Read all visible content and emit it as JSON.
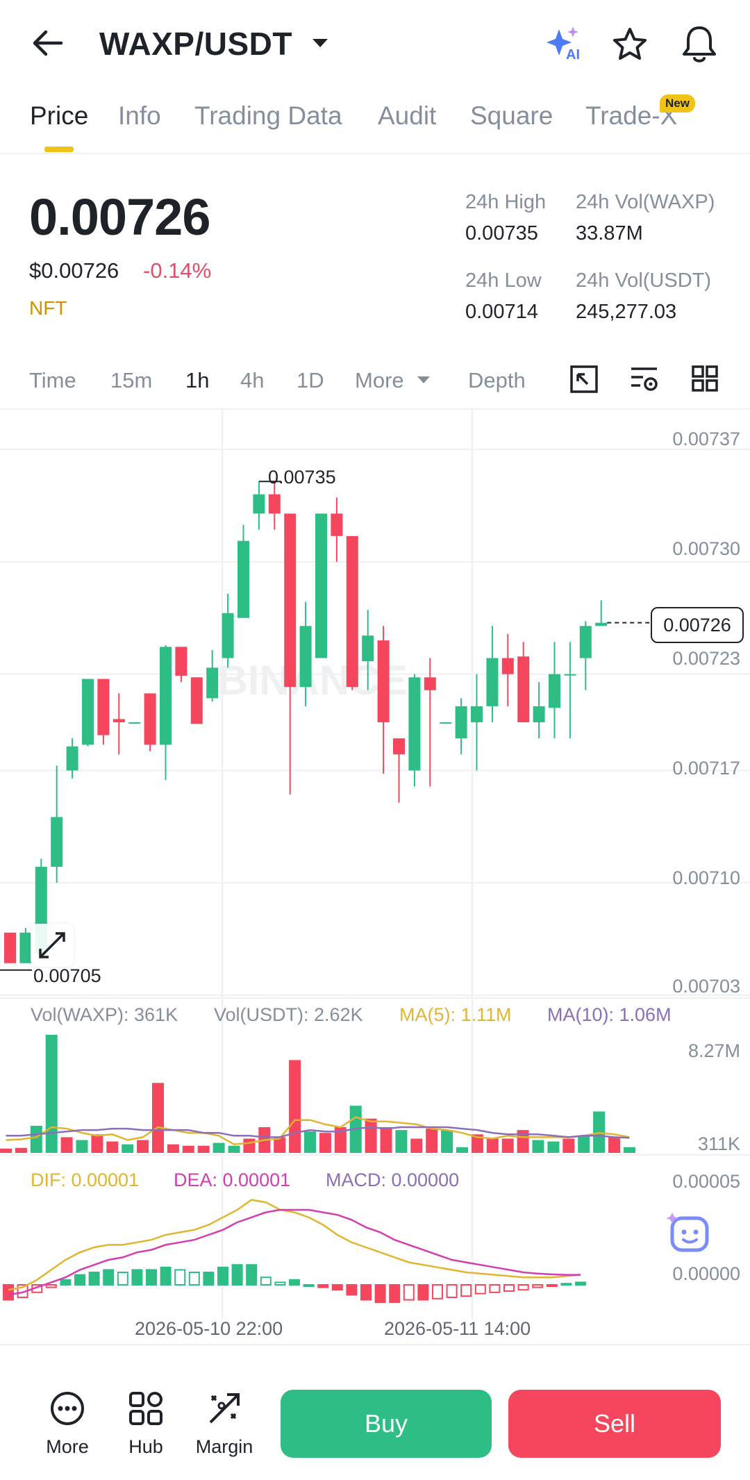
{
  "header": {
    "title": "WAXP/USDT",
    "ai_badge": "AI"
  },
  "tabs": [
    {
      "label": "Price"
    },
    {
      "label": "Info"
    },
    {
      "label": "Trading Data"
    },
    {
      "label": "Audit"
    },
    {
      "label": "Square"
    },
    {
      "label": "Trade-X"
    }
  ],
  "new_badge": "New",
  "ticker": {
    "price": "0.00726",
    "usd_price": "$0.00726",
    "change": "-0.14%",
    "tag": "NFT",
    "high_label": "24h High",
    "high": "0.00735",
    "low_label": "24h Low",
    "low": "0.00714",
    "vol_base_label": "24h Vol(WAXP)",
    "vol_base": "33.87M",
    "vol_quote_label": "24h Vol(USDT)",
    "vol_quote": "245,277.03"
  },
  "timeframes": [
    {
      "label": "Time"
    },
    {
      "label": "15m"
    },
    {
      "label": "1h"
    },
    {
      "label": "4h"
    },
    {
      "label": "1D"
    },
    {
      "label": "More"
    },
    {
      "label": "Depth"
    }
  ],
  "chart_data": {
    "type": "candlestick",
    "watermark": "BINANCE",
    "price_axis": [
      "0.00737",
      "0.00730",
      "0.00723",
      "0.00717",
      "0.00710",
      "0.00703"
    ],
    "ylim": [
      0.00703,
      0.00737
    ],
    "high_marker": "0.00735",
    "low_marker": "0.00705",
    "current_price_label": "0.00726",
    "colors": {
      "up": "#2ebd85",
      "down": "#f6465d",
      "ma5": "#e1b530",
      "ma10": "#8a6fb6",
      "dif": "#e1b530",
      "dea": "#d23db0"
    },
    "candles": [
      {
        "o": 0.007069,
        "h": 0.007069,
        "l": 0.00705,
        "c": 0.00705
      },
      {
        "o": 0.00705,
        "h": 0.007072,
        "l": 0.00705,
        "c": 0.007069
      },
      {
        "o": 0.007056,
        "h": 0.007115,
        "l": 0.007052,
        "c": 0.00711
      },
      {
        "o": 0.00711,
        "h": 0.007173,
        "l": 0.0071,
        "c": 0.007141
      },
      {
        "o": 0.00717,
        "h": 0.00719,
        "l": 0.007165,
        "c": 0.007185
      },
      {
        "o": 0.007186,
        "h": 0.007227,
        "l": 0.007185,
        "c": 0.007227
      },
      {
        "o": 0.007227,
        "h": 0.007227,
        "l": 0.007186,
        "c": 0.007192
      },
      {
        "o": 0.007202,
        "h": 0.007218,
        "l": 0.00718,
        "c": 0.0072
      },
      {
        "o": 0.0072,
        "h": 0.0072,
        "l": 0.0072,
        "c": 0.0072
      },
      {
        "o": 0.007218,
        "h": 0.007218,
        "l": 0.007182,
        "c": 0.007186
      },
      {
        "o": 0.007186,
        "h": 0.007248,
        "l": 0.007164,
        "c": 0.007247
      },
      {
        "o": 0.007247,
        "h": 0.007247,
        "l": 0.007225,
        "c": 0.007229
      },
      {
        "o": 0.007228,
        "h": 0.007228,
        "l": 0.007199,
        "c": 0.007199
      },
      {
        "o": 0.007215,
        "h": 0.007245,
        "l": 0.007213,
        "c": 0.007234
      },
      {
        "o": 0.00724,
        "h": 0.00728,
        "l": 0.007234,
        "c": 0.007268
      },
      {
        "o": 0.007265,
        "h": 0.007323,
        "l": 0.007265,
        "c": 0.007313
      },
      {
        "o": 0.00733,
        "h": 0.00735,
        "l": 0.00732,
        "c": 0.007342
      },
      {
        "o": 0.007342,
        "h": 0.00735,
        "l": 0.00732,
        "c": 0.00733
      },
      {
        "o": 0.00733,
        "h": 0.00733,
        "l": 0.007155,
        "c": 0.007222
      },
      {
        "o": 0.007222,
        "h": 0.007275,
        "l": 0.00721,
        "c": 0.00726
      },
      {
        "o": 0.00724,
        "h": 0.00733,
        "l": 0.00724,
        "c": 0.00733
      },
      {
        "o": 0.00733,
        "h": 0.00734,
        "l": 0.0073,
        "c": 0.007316
      },
      {
        "o": 0.007316,
        "h": 0.007316,
        "l": 0.00722,
        "c": 0.007222
      },
      {
        "o": 0.007238,
        "h": 0.00727,
        "l": 0.00722,
        "c": 0.007254
      },
      {
        "o": 0.007251,
        "h": 0.00726,
        "l": 0.007168,
        "c": 0.0072
      },
      {
        "o": 0.00719,
        "h": 0.00719,
        "l": 0.00715,
        "c": 0.00718
      },
      {
        "o": 0.00717,
        "h": 0.00723,
        "l": 0.00716,
        "c": 0.007228
      },
      {
        "o": 0.007228,
        "h": 0.00724,
        "l": 0.00716,
        "c": 0.00722
      },
      {
        "o": 0.0072,
        "h": 0.0072,
        "l": 0.0072,
        "c": 0.0072
      },
      {
        "o": 0.00719,
        "h": 0.007215,
        "l": 0.00718,
        "c": 0.00721
      },
      {
        "o": 0.0072,
        "h": 0.00723,
        "l": 0.00717,
        "c": 0.00721
      },
      {
        "o": 0.00721,
        "h": 0.00726,
        "l": 0.0072,
        "c": 0.00724
      },
      {
        "o": 0.00724,
        "h": 0.007255,
        "l": 0.00721,
        "c": 0.00723
      },
      {
        "o": 0.007241,
        "h": 0.00725,
        "l": 0.0072,
        "c": 0.0072
      },
      {
        "o": 0.0072,
        "h": 0.007225,
        "l": 0.00719,
        "c": 0.00721
      },
      {
        "o": 0.007209,
        "h": 0.00725,
        "l": 0.00719,
        "c": 0.00723
      },
      {
        "o": 0.00723,
        "h": 0.00725,
        "l": 0.00719,
        "c": 0.00723
      },
      {
        "o": 0.00724,
        "h": 0.007263,
        "l": 0.00722,
        "c": 0.00726
      },
      {
        "o": 0.00726,
        "h": 0.007276,
        "l": 0.00726,
        "c": 0.007262
      }
    ],
    "volume_panel": {
      "vol_base_label": "Vol(WAXP): 361K",
      "vol_quote_label": "Vol(USDT): 2.62K",
      "ma5_label": "MA(5): 1.11M",
      "ma10_label": "MA(10): 1.06M",
      "axis_max": "8.27M",
      "axis_min": "311K",
      "volumes": [
        0.3,
        0.35,
        1.9,
        8.27,
        1.1,
        0.9,
        1.3,
        0.8,
        0.6,
        0.9,
        4.9,
        0.6,
        0.5,
        0.5,
        0.7,
        0.5,
        1.0,
        1.8,
        1.1,
        6.5,
        1.5,
        1.4,
        1.8,
        3.3,
        2.4,
        1.8,
        1.6,
        1.0,
        1.7,
        1.6,
        0.4,
        1.3,
        1.0,
        1.0,
        1.6,
        0.9,
        0.8,
        1.0,
        1.2,
        2.9,
        1.1,
        0.4
      ],
      "ma5": [
        0.9,
        0.95,
        1.1,
        1.8,
        1.7,
        1.4,
        1.2,
        1.3,
        0.9,
        1.1,
        1.8,
        1.6,
        1.4,
        1.4,
        1.2,
        0.6,
        0.7,
        0.9,
        1.0,
        2.3,
        2.3,
        2.0,
        1.8,
        2.5,
        2.2,
        2.2,
        2.1,
        2.0,
        1.7,
        1.6,
        1.4,
        1.1,
        1.0,
        1.2,
        1.1,
        1.1,
        1.1,
        1.1,
        1.2,
        1.4,
        1.3,
        1.1
      ],
      "ma10": [
        1.2,
        1.2,
        1.3,
        1.4,
        1.5,
        1.6,
        1.6,
        1.7,
        1.7,
        1.6,
        1.6,
        1.6,
        1.6,
        1.4,
        1.4,
        1.2,
        1.2,
        1.1,
        1.1,
        1.4,
        1.6,
        1.5,
        1.5,
        1.7,
        1.8,
        1.7,
        1.8,
        1.8,
        1.8,
        1.8,
        1.7,
        1.6,
        1.4,
        1.3,
        1.3,
        1.3,
        1.2,
        1.1,
        1.2,
        1.2,
        1.1,
        1.06
      ]
    },
    "macd_panel": {
      "dif_label": "DIF: 0.00001",
      "dea_label": "DEA: 0.00001",
      "macd_label": "MACD: 0.00000",
      "axis_max": "0.00005",
      "axis_mid": "0.00000",
      "hist": [
        -0.6,
        -0.5,
        -0.3,
        -0.1,
        0.2,
        0.4,
        0.5,
        0.6,
        0.5,
        0.6,
        0.6,
        0.7,
        0.6,
        0.5,
        0.5,
        0.7,
        0.8,
        0.8,
        0.3,
        0.1,
        0.2,
        0.0,
        -0.1,
        -0.2,
        -0.4,
        -0.6,
        -0.7,
        -0.7,
        -0.6,
        -0.6,
        -0.55,
        -0.5,
        -0.45,
        -0.35,
        -0.3,
        -0.25,
        -0.2,
        -0.1,
        -0.05,
        0.05,
        0.1
      ],
      "dif": [
        -0.2,
        -0.1,
        0.2,
        0.6,
        1.0,
        1.3,
        1.5,
        1.6,
        1.6,
        1.7,
        1.8,
        2.0,
        2.1,
        2.2,
        2.4,
        2.7,
        3.0,
        3.4,
        3.3,
        3.0,
        2.9,
        2.7,
        2.4,
        2.0,
        1.7,
        1.5,
        1.3,
        1.1,
        0.9,
        0.8,
        0.7,
        0.6,
        0.5,
        0.45,
        0.4,
        0.35,
        0.3,
        0.3,
        0.3,
        0.35,
        0.4
      ],
      "dea": [
        -0.4,
        -0.3,
        -0.1,
        0.1,
        0.3,
        0.6,
        0.8,
        1.0,
        1.1,
        1.3,
        1.4,
        1.6,
        1.7,
        1.8,
        2.0,
        2.2,
        2.5,
        2.7,
        2.9,
        3.0,
        3.0,
        3.0,
        2.9,
        2.8,
        2.6,
        2.3,
        2.1,
        1.8,
        1.6,
        1.4,
        1.2,
        1.0,
        0.9,
        0.8,
        0.7,
        0.6,
        0.5,
        0.45,
        0.42,
        0.4,
        0.4
      ]
    },
    "x_labels": [
      "2026-05-10 22:00",
      "2026-05-11 14:00"
    ]
  },
  "bottom_nav": [
    {
      "label": "More",
      "icon": "dots-circle-icon"
    },
    {
      "label": "Hub",
      "icon": "grid-icon"
    },
    {
      "label": "Margin",
      "icon": "margin-icon"
    }
  ],
  "actions": {
    "buy": "Buy",
    "sell": "Sell"
  }
}
